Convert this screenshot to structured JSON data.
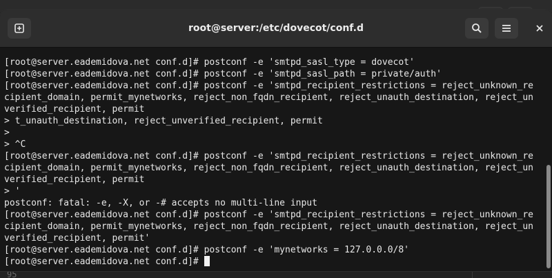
{
  "window": {
    "title": "root@server:/etc/dovecot/conf.d"
  },
  "titlebar": {
    "new_tab_icon": "new-tab-icon",
    "search_icon": "search-icon",
    "menu_icon": "hamburger-menu-icon",
    "close_label": "×"
  },
  "terminal": {
    "lines": [
      "[root@server.eademidova.net conf.d]# postconf -e 'smtpd_sasl_type = dovecot'",
      "[root@server.eademidova.net conf.d]# postconf -e 'smtpd_sasl_path = private/auth'",
      "[root@server.eademidova.net conf.d]# postconf -e 'smtpd_recipient_restrictions = reject_unknown_re",
      "cipient_domain, permit_mynetworks, reject_non_fqdn_recipient, reject_unauth_destination, reject_un",
      "verified_recipient, permit",
      "> t_unauth_destination, reject_unverified_recipient, permit",
      ">",
      "> ^C",
      "[root@server.eademidova.net conf.d]# postconf -e 'smtpd_recipient_restrictions = reject_unknown_re",
      "cipient_domain, permit_mynetworks, reject_non_fqdn_recipient, reject_unauth_destination, reject_un",
      "verified_recipient, permit",
      "> '",
      "postconf: fatal: -e, -X, or -# accepts no multi-line input",
      "[root@server.eademidova.net conf.d]# postconf -e 'smtpd_recipient_restrictions = reject_unknown_re",
      "cipient_domain, permit_mynetworks, reject_non_fqdn_recipient, reject_unauth_destination, reject_un",
      "verified_recipient, permit'",
      "[root@server.eademidova.net conf.d]# postconf -e 'mynetworks = 127.0.0.0/8'",
      "[root@server.eademidova.net conf.d]#"
    ]
  },
  "background": {
    "bottom_text": "95"
  }
}
